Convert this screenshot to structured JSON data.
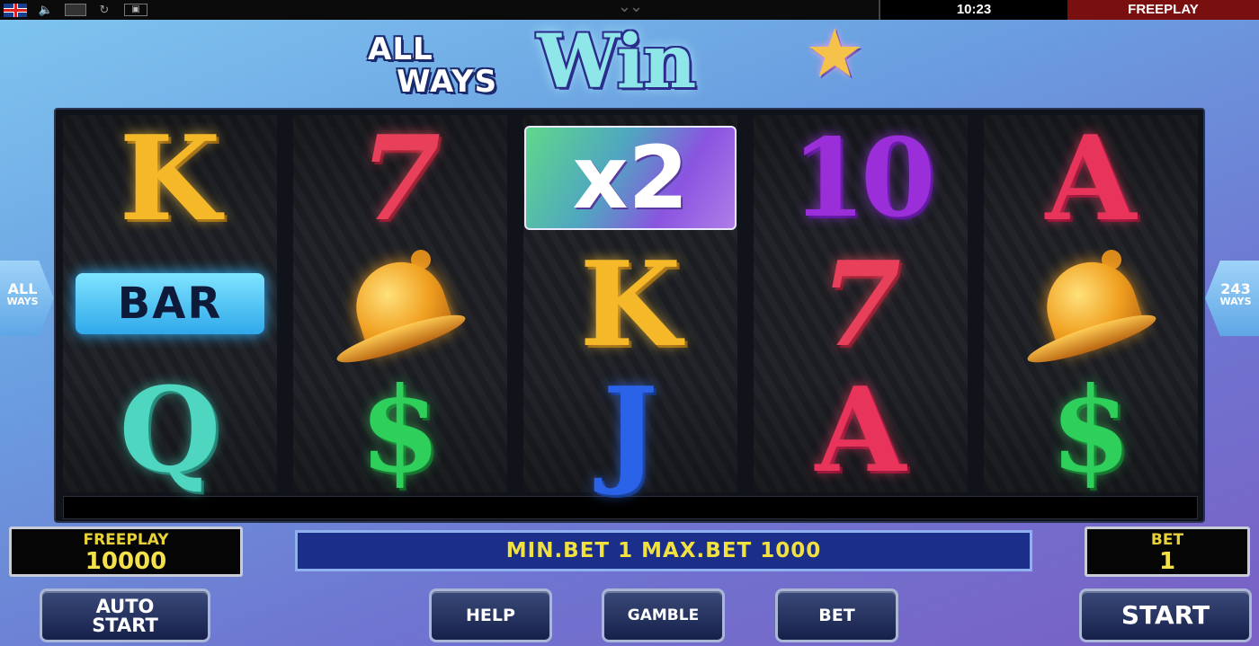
{
  "topbar": {
    "clock": "10:23",
    "mode": "FREEPLAY",
    "icons": [
      "uk-flag-icon",
      "sound-icon",
      "fullscreen-icon",
      "refresh-icon",
      "exit-icon"
    ]
  },
  "logo": {
    "line1": "ALL",
    "line2": "WAYS",
    "word": "Win",
    "star": "★"
  },
  "ways": {
    "left_big": "ALL",
    "left_small": "WAYS",
    "right_big": "243",
    "right_small": "WAYS"
  },
  "reels": [
    [
      "K",
      "BAR",
      "Q"
    ],
    [
      "7",
      "bell",
      "$"
    ],
    [
      "x2",
      "K",
      "J"
    ],
    [
      "10",
      "7",
      "A"
    ],
    [
      "A",
      "bell",
      "$"
    ]
  ],
  "credit": {
    "label": "FREEPLAY",
    "value": "10000"
  },
  "message": "MIN.BET 1 MAX.BET 1000",
  "bet": {
    "label": "BET",
    "value": "1"
  },
  "buttons": {
    "auto_line1": "AUTO",
    "auto_line2": "START",
    "help": "HELP",
    "gamble": "GAMBLE",
    "bet": "BET",
    "start": "START"
  },
  "colors": {
    "freeplay_banner": "#7a0f0f",
    "display_text": "#f0e040",
    "message_bg": "#1a2e8a"
  }
}
